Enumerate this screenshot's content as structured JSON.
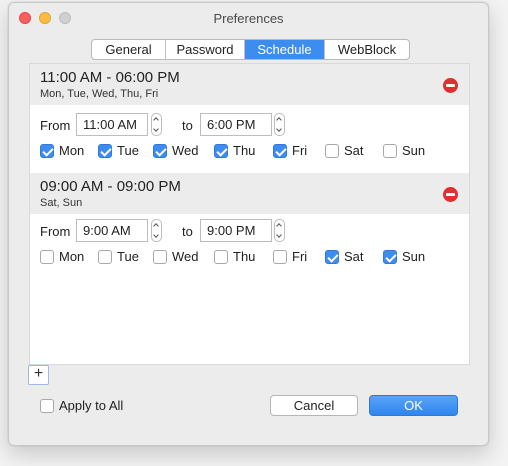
{
  "window": {
    "title": "Preferences"
  },
  "tabs": [
    {
      "label": "General",
      "active": false
    },
    {
      "label": "Password",
      "active": false
    },
    {
      "label": "Schedule",
      "active": true
    },
    {
      "label": "WebBlock",
      "active": false
    }
  ],
  "schedules": [
    {
      "time_range": "11:00 AM  -  06:00 PM",
      "days_summary": "Mon, Tue, Wed, Thu, Fri",
      "from_label": "From",
      "from_value": "11:00 AM",
      "to_label": "to",
      "to_value": "6:00 PM",
      "days": [
        {
          "label": "Mon",
          "checked": true
        },
        {
          "label": "Tue",
          "checked": true
        },
        {
          "label": "Wed",
          "checked": true
        },
        {
          "label": "Thu",
          "checked": true
        },
        {
          "label": "Fri",
          "checked": true
        },
        {
          "label": "Sat",
          "checked": false
        },
        {
          "label": "Sun",
          "checked": false
        }
      ]
    },
    {
      "time_range": "09:00 AM  -  09:00 PM",
      "days_summary": "Sat, Sun",
      "from_label": "From",
      "from_value": "9:00 AM",
      "to_label": "to",
      "to_value": "9:00 PM",
      "days": [
        {
          "label": "Mon",
          "checked": false
        },
        {
          "label": "Tue",
          "checked": false
        },
        {
          "label": "Wed",
          "checked": false
        },
        {
          "label": "Thu",
          "checked": false
        },
        {
          "label": "Fri",
          "checked": false
        },
        {
          "label": "Sat",
          "checked": true
        },
        {
          "label": "Sun",
          "checked": true
        }
      ]
    }
  ],
  "add_button": {
    "label": "+"
  },
  "footer": {
    "apply_all_label": "Apply to All",
    "apply_all_checked": false,
    "cancel_label": "Cancel",
    "ok_label": "OK"
  },
  "colors": {
    "accent": "#3d8df0",
    "remove": "#e02f2f",
    "section_bg": "#ececec"
  }
}
